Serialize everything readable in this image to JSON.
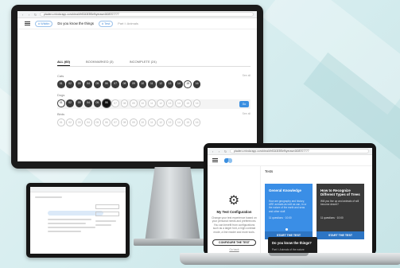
{
  "monitor": {
    "browser": {
      "url": "ptadero.mindcrapp.com/ctea/#fr5343f3f5efhyerase4608707777"
    },
    "header": {
      "pill_label": "# Wikitin",
      "title": "Do you know the things",
      "pill2_label": "# Test",
      "subtitle": "Part I: Animals"
    },
    "tabs": [
      {
        "label": "ALL (60)",
        "active": true
      },
      {
        "label": "BOOKMARKED (3)",
        "active": false
      },
      {
        "label": "INCOMPLETE (24)",
        "active": false
      }
    ],
    "sections": [
      {
        "title": "Cats",
        "right": "See all",
        "items": [
          {
            "n": "01",
            "s": "f"
          },
          {
            "n": "02",
            "s": "f"
          },
          {
            "n": "03",
            "s": "f"
          },
          {
            "n": "04",
            "s": "f"
          },
          {
            "n": "05",
            "s": "f"
          },
          {
            "n": "06",
            "s": "f"
          },
          {
            "n": "07",
            "s": "f"
          },
          {
            "n": "08",
            "s": "f"
          },
          {
            "n": "09",
            "s": "f"
          },
          {
            "n": "10",
            "s": "f"
          },
          {
            "n": "11",
            "s": "f"
          },
          {
            "n": "12",
            "s": "f"
          },
          {
            "n": "13",
            "s": "f"
          },
          {
            "n": "14",
            "s": "f"
          },
          {
            "n": "15",
            "s": "sel"
          },
          {
            "n": "16",
            "s": "f"
          }
        ]
      },
      {
        "title": "Dogs",
        "right": "",
        "go_label": "Go",
        "items": [
          {
            "n": "01",
            "s": "sel"
          },
          {
            "n": "02",
            "s": "f"
          },
          {
            "n": "03",
            "s": "f"
          },
          {
            "n": "04",
            "s": "f"
          },
          {
            "n": "05",
            "s": "f"
          },
          {
            "n": "06",
            "s": "dark"
          },
          {
            "n": "07",
            "s": "o"
          },
          {
            "n": "08",
            "s": "o"
          },
          {
            "n": "09",
            "s": "o"
          },
          {
            "n": "10",
            "s": "o"
          },
          {
            "n": "11",
            "s": "o"
          },
          {
            "n": "12",
            "s": "o"
          },
          {
            "n": "13",
            "s": "o"
          },
          {
            "n": "14",
            "s": "o"
          },
          {
            "n": "15",
            "s": "o"
          },
          {
            "n": "16",
            "s": "o"
          }
        ]
      },
      {
        "title": "Birds",
        "right": "See all",
        "items": [
          {
            "n": "01",
            "s": "o"
          },
          {
            "n": "02",
            "s": "o"
          },
          {
            "n": "03",
            "s": "o"
          },
          {
            "n": "04",
            "s": "o"
          },
          {
            "n": "05",
            "s": "o"
          },
          {
            "n": "06",
            "s": "o"
          },
          {
            "n": "07",
            "s": "o"
          },
          {
            "n": "08",
            "s": "o"
          },
          {
            "n": "09",
            "s": "o"
          },
          {
            "n": "10",
            "s": "o"
          },
          {
            "n": "11",
            "s": "o"
          },
          {
            "n": "12",
            "s": "o"
          },
          {
            "n": "13",
            "s": "o"
          },
          {
            "n": "14",
            "s": "o"
          },
          {
            "n": "15",
            "s": "o"
          },
          {
            "n": "16",
            "s": "o"
          }
        ]
      }
    ]
  },
  "laptop": {
    "browser": {
      "url": "ptadero.mindcrapp.com/ctea/#fr5343f3f5efhyerase4608707777"
    },
    "left": {
      "title": "My Test Configuration",
      "description": "Change your test experience based on your personal needs and preferences. You can benefit from configurations such as a larger font, a high contrast mode, a line reader and more tools.",
      "button": "CONFIGURE THE TEST",
      "link": "Go back"
    },
    "tests_label": "Tests",
    "cards": [
      {
        "title": "General Knowledge",
        "description": "How are geography and history, ARE animals as well as can, in or the nature of the earth and seas and other stuff.",
        "meta": "11 questions · 10:00",
        "cta": "START THE TEST"
      },
      {
        "title": "How to Recognize Different Types of Trees",
        "description": "Will you live up and animals of will become desert?",
        "meta": "11 questions · 10:00",
        "cta": "START THE TEST"
      }
    ],
    "popover": {
      "title": "Do you know the things?",
      "subtitle": "Part I: Animals of the nature"
    }
  },
  "colors": {
    "accent": "#3a8ee6",
    "dark": "#3a3a3a",
    "background": "#d4ecee"
  },
  "icons": {
    "gear": "⚙",
    "back": "‹",
    "forward": "›",
    "reload": "↻"
  }
}
